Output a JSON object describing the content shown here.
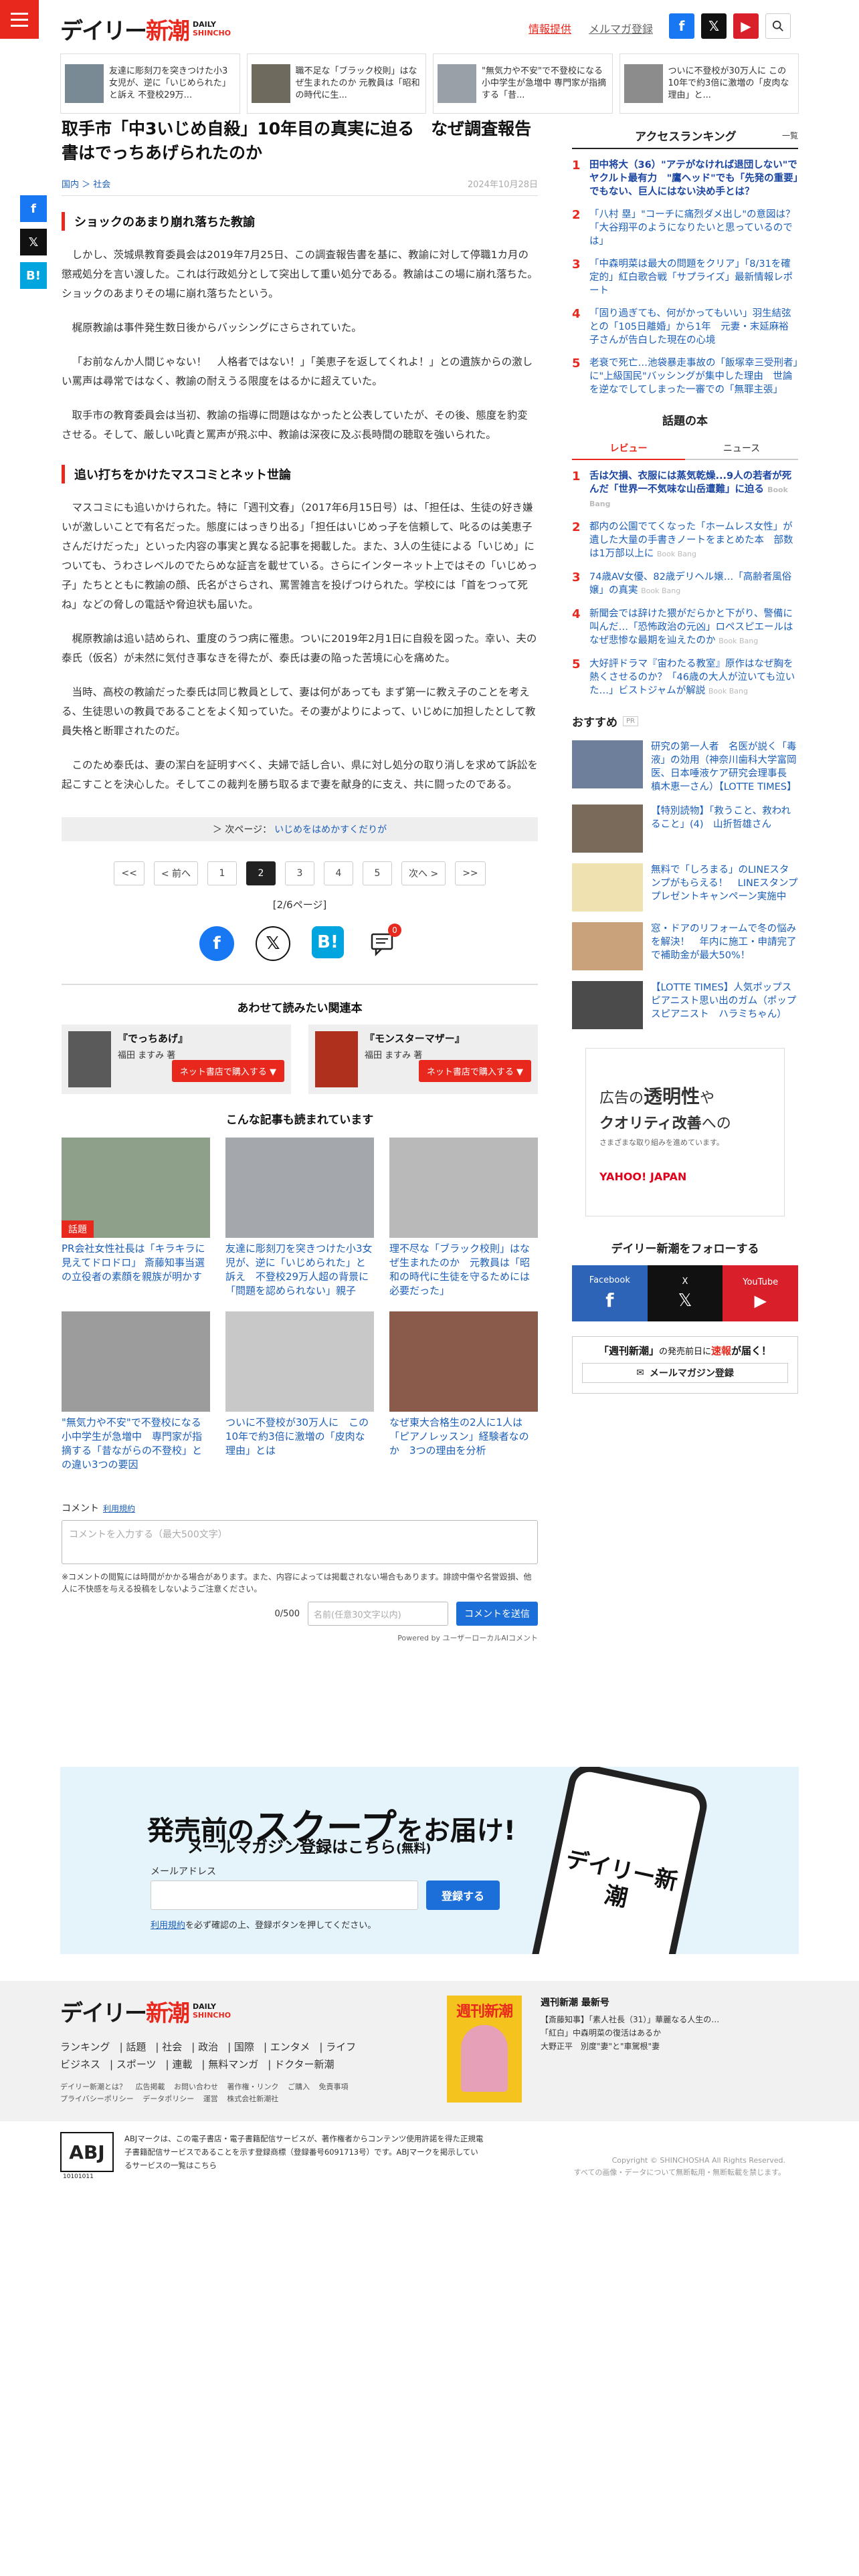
{
  "header": {
    "logo_main": "デイリー新潮",
    "logo_sub1": "DAILY",
    "logo_sub2": "SHINCHO",
    "tip_link": "情報提供",
    "mail_link": "メルマガ登録"
  },
  "top_strip": [
    "友達に彫刻刀を突きつけた小3女児が、逆に「いじめられた」と訴え 不登校29万...",
    "職不足な「ブラック校則」はなぜ生まれたのか 元教員は「昭和の時代に生...",
    "\"無気力や不安\"で不登校になる小中学生が急増中 専門家が指摘する「昔...",
    "ついに不登校が30万人に この10年で約3倍に激増の「皮肉な理由」と..."
  ],
  "article": {
    "title": "取手市「中3いじめ自殺」10年目の真実に迫る　なぜ調査報告書はでっちあげられたのか",
    "cats": "国内 ＞ 社会",
    "date": "2024年10月28日",
    "sec1": "ショックのあまり崩れ落ちた教諭",
    "p1": "しかし、茨城県教育委員会は2019年7月25日、この調査報告書を基に、教諭に対して停職1カ月の懲戒処分を言い渡した。これは行政処分として突出して重い処分である。教諭はこの場に崩れ落ちた。ショックのあまりその場に崩れ落ちたという。",
    "p2": "梶原教諭は事件発生数日後からバッシングにさらされていた。",
    "p3": "「お前なんか人間じゃない！　人格者ではない！」「美恵子を返してくれよ！」との遺族からの激しい罵声は尋常ではなく、教諭の耐えうる限度をはるかに超えていた。",
    "p4": "取手市の教育委員会は当初、教諭の指導に問題はなかったと公表していたが、その後、態度を豹変させる。そして、厳しい叱責と罵声が飛ぶ中、教諭は深夜に及ぶ長時間の聴取を強いられた。",
    "sec2": "追い打ちをかけたマスコミとネット世論",
    "p5": "マスコミにも追いかけられた。特に「週刊文春」（2017年6月15日号）は、「担任は、生徒の好き嫌いが激しいことで有名だった。態度にはっきり出る」「担任はいじめっ子を信頼して、叱るのは美恵子さんだけだった」といった内容の事実と異なる記事を掲載した。また、3人の生徒による「いじめ」についても、うわさレベルのでたらめな証言を載せている。さらにインターネット上ではその「いじめっ子」たちとともに教諭の顔、氏名がさらされ、罵詈雑言を投げつけられた。学校には「首をつって死ね」などの脅しの電話や脅迫状も届いた。",
    "p6": "梶原教諭は追い詰められ、重度のうつ病に罹患。ついに2019年2月1日に自殺を図った。幸い、夫の泰氏（仮名）が未然に気付き事なきを得たが、泰氏は妻の陥った苦境に心を痛めた。",
    "p7": "当時、高校の教諭だった泰氏は同じ教員として、妻は何があっても まず第一に教え子のことを考える、生徒思いの教員であることをよく知っていた。その妻がよりによって、いじめに加担したとして教員失格と断罪されたのだ。",
    "p8": "このため泰氏は、妻の潔白を証明すべく、夫婦で話し合い、県に対し処分の取り消しを求めて訴訟を起こすことを決心した。そしてこの裁判を勝ち取るまで妻を献身的に支え、共に闘ったのである。",
    "next_label": "＞ 次ページ：",
    "next_link": "いじめをはめかすくだりが",
    "pager": [
      "<<",
      "< 前へ",
      "1",
      "2",
      "3",
      "4",
      "5",
      "次へ >",
      ">>"
    ],
    "page_count": "[2/6ページ]",
    "comment_badge": "0"
  },
  "related": {
    "title": "あわせて読みたい関連本",
    "books": [
      {
        "title": "『でっちあげ』",
        "author_label": "福田 ますみ 著",
        "btn": "ネット書店で購入する ▼"
      },
      {
        "title": "『モンスターマザー』",
        "author_label": "福田 ますみ 著",
        "btn": "ネット書店で購入する ▼"
      }
    ]
  },
  "also_read": {
    "title": "こんな記事も読まれています",
    "items": [
      {
        "text": "PR会社女性社長は「キラキラに見えてドロドロ」 斎藤知事当選の立役者の素顔を親族が明かす",
        "tag": "話題"
      },
      {
        "text": "友達に彫刻刀を突きつけた小3女児が、逆に「いじめられた」と訴え　不登校29万人超の背景に「問題を認められない」親子",
        "tag": ""
      },
      {
        "text": "理不尽な「ブラック校則」はなぜ生まれたのか　元教員は「昭和の時代に生徒を守るためには必要だった」",
        "tag": ""
      },
      {
        "text": "\"無気力や不安\"で不登校になる小中学生が急増中　専門家が指摘する「昔ながらの不登校」との違い3つの要因",
        "tag": ""
      },
      {
        "text": "ついに不登校が30万人に　この10年で約3倍に激増の「皮肉な理由」とは",
        "tag": ""
      },
      {
        "text": "なぜ東大合格生の2人に1人は「ピアノレッスン」経験者なのか　3つの理由を分析",
        "tag": ""
      }
    ]
  },
  "comment": {
    "label": "コメント",
    "rule": "利用規約",
    "placeholder": "コメントを入力する（最大500文字）",
    "note": "※コメントの閲覧には時間がかかる場合があります。また、内容によっては掲載されない場合もあります。誹謗中傷や名誉毀損、他人に不快感を与える投稿をしないようご注意ください。",
    "count": "0/500",
    "name_placeholder": "名前(任意30文字以内)",
    "send": "コメントを送信",
    "powered": "Powered by ユーザーローカルAIコメント"
  },
  "sidebar": {
    "rank_title": "アクセスランキング",
    "rank_more": "一覧",
    "ranking": [
      {
        "n": "1",
        "t": "田中将大（36）\"アテがなければ退団しない\"でヤクルト最有力　\"鷹ヘッド\"でも「先発の重要」でもない、巨人にはない決め手とは？",
        "b": true
      },
      {
        "n": "2",
        "t": "「八村 塁」\"コーチに痛烈ダメ出し\"の意図は？「大谷翔平のようになりたいと思っているのでは」",
        "b": false
      },
      {
        "n": "3",
        "t": "「中森明菜は最大の問題をクリア」「8/31を確定的」紅白歌合戦「サプライズ」最新情報レポート",
        "b": false
      },
      {
        "n": "4",
        "t": "「固り過ぎても、何がかってもいい」羽生結弦との「105日離婚」から1年　元妻・末延麻裕子さんが告白した現在の心境",
        "b": false
      },
      {
        "n": "5",
        "t": "老衰で死亡…池袋暴走事故の「飯塚幸三受刑者」に\"上級国民\"バッシングが集中した理由　世論を逆なでしてしまった一審での「無罪主張」",
        "b": false
      }
    ],
    "book_rank_title": "話題の本",
    "tabs": [
      "レビュー",
      "ニュース"
    ],
    "book_rank": [
      {
        "n": "1",
        "t": "舌は欠損、衣服には蒸気乾燥...9人の若者が死んだ「世界一不気味な山岳遭難」に迫る",
        "src": "Book Bang",
        "b": true
      },
      {
        "n": "2",
        "t": "都内の公園でてくなった「ホームレス女性」が遺した大量の手書きノートをまとめた本　部数は1万部以上に",
        "src": "Book Bang",
        "b": false
      },
      {
        "n": "3",
        "t": "74歳AV女優、82歳デリヘル嬢…「高齢者風俗嬢」の真実",
        "src": "Book Bang",
        "b": false
      },
      {
        "n": "4",
        "t": "新聞会では辞けた猥がだらかと下がり、警備に叫んだ…「恐怖政治の元凶」ロペスピエールはなぜ悲惨な最期を辿えたのか",
        "src": "Book Bang",
        "b": false
      },
      {
        "n": "5",
        "t": "大好評ドラマ『宙わたる教室』原作はなぜ胸を熱くさせるのか？「46歳の大人が泣いても泣いた…」ビストジャムが解説",
        "src": "Book Bang",
        "b": false
      }
    ],
    "osusume": "おすすめ",
    "pr": "PR",
    "ads": [
      {
        "t": "研究の第一人者　名医が説く「毒液」の効用（神奈川歯科大学富岡医、日本唾液ケア研究会理事長　槙木恵一さん）【LOTTE TIMES】"
      },
      {
        "t": "【特別読物】「救うこと、救われること」(4)　山折哲雄さん"
      },
      {
        "t": "無料で「しろまる」のLINEスタンプがもらえる！　LINEスタンププレゼントキャンペーン実施中"
      },
      {
        "t": "窓・ドアのリフォームで冬の悩みを解決！　年内に施工・申請完了で補助金が最大50%！"
      },
      {
        "t": "【LOTTE TIMES】人気ポップスピアニスト思い出のガム（ポップスピアニスト　ハラミちゃん）"
      }
    ],
    "big_ad": {
      "l1a": "広告の",
      "l1b": "透明性",
      "l1c": "や",
      "l2a": "クオリティ改善",
      "l2b": "への",
      "l3": "さまざまな取り組みを進めています。",
      "brand": "YAHOO! JAPAN"
    },
    "follow_title": "デイリー新潮をフォローする",
    "follow": [
      "Facebook",
      "X",
      "YouTube"
    ],
    "weekly": {
      "t1": "「週刊新潮」",
      "t2": "の発売前日に",
      "t3": "速報",
      "t4": "が届く！",
      "btn": "メールマガジン登録"
    }
  },
  "scoop": {
    "h_a": "発売前の",
    "h_b": "スクープ",
    "h_c": "をお届け!",
    "sub_a": "メールマガジン登録はこちら",
    "sub_b": "(無料)",
    "mail_label": "メールアドレス",
    "reg": "登録する",
    "note_a": "利用規約",
    "note_b": "を必ず確認の上、登録ボタンを押してください。",
    "phone_logo": "デイリー新潮"
  },
  "footer": {
    "nav1": [
      "ランキング",
      "話題",
      "社会",
      "政治",
      "国際",
      "エンタメ",
      "ライフ"
    ],
    "nav2": [
      "ビジネス",
      "スポーツ",
      "連載",
      "無料マンガ",
      "ドクター新潮"
    ],
    "small1": [
      "デイリー新潮とは？",
      "広告掲載",
      "お問い合わせ",
      "著作権・リンク",
      "ご購入",
      "免責事項"
    ],
    "small2": [
      "プライバシーポリシー",
      "データポリシー",
      "運営",
      "株式会社新潮社"
    ],
    "mag_title": "週刊新潮",
    "latest_h": "週刊新潮 最新号",
    "latest": [
      "【斎藤知事】「素人社長（31）」華麗なる人生の…",
      "「紅白」中森明菜の復活はあるか",
      "大野正平　別度\"妻\"と\"車駕根\"妻"
    ]
  },
  "abj": {
    "mark": "ABJ",
    "num": "10101011",
    "text": "ABJマークは、この電子書店・電子書籍配信サービスが、著作権者からコンテンツ使用許諾を得た正規電子書籍配信サービスであることを示す登録商標（登録番号6091713号）です。ABJマークを掲示しているサービスの一覧はこちら",
    "copy1": "Copyright © SHINCHOSHA All Rights Reserved.",
    "copy2": "すべての画像・データについて無断転用・無断転載を禁じます。"
  }
}
